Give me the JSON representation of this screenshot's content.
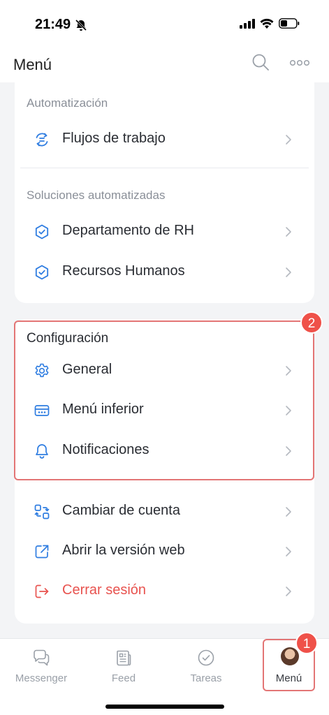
{
  "status_bar": {
    "time": "21:49"
  },
  "header": {
    "title": "Menú",
    "search_icon": "search-icon",
    "more_icon": "more-icon"
  },
  "automation": {
    "section_title": "Automatización",
    "items": [
      {
        "label": "Flujos de trabajo",
        "icon": "workflow-icon"
      }
    ]
  },
  "solutions": {
    "section_title": "Soluciones automatizadas",
    "items": [
      {
        "label": "Departamento de RH",
        "icon": "hexagon-check-icon"
      },
      {
        "label": "Recursos Humanos",
        "icon": "hexagon-check-icon"
      }
    ]
  },
  "settings": {
    "section_title": "Configuración",
    "items": [
      {
        "label": "General",
        "icon": "gear-icon"
      },
      {
        "label": "Menú inferior",
        "icon": "bottom-menu-icon"
      },
      {
        "label": "Notificaciones",
        "icon": "bell-icon"
      }
    ]
  },
  "account": {
    "items": [
      {
        "label": "Cambiar de cuenta",
        "icon": "switch-account-icon"
      },
      {
        "label": "Abrir la versión web",
        "icon": "external-link-icon"
      },
      {
        "label": "Cerrar sesión",
        "icon": "logout-icon",
        "color": "#e8534f"
      }
    ]
  },
  "annotations": {
    "badge_1": "1",
    "badge_2": "2",
    "color": "#ef5149"
  },
  "tabbar": {
    "tabs": [
      {
        "label": "Messenger",
        "icon": "chat-icon"
      },
      {
        "label": "Feed",
        "icon": "feed-icon"
      },
      {
        "label": "Tareas",
        "icon": "check-circle-icon"
      },
      {
        "label": "Menú",
        "icon": "avatar",
        "active": true
      }
    ]
  },
  "colors": {
    "accent": "#2f7de1",
    "danger": "#e8534f",
    "highlight": "#e37575"
  }
}
